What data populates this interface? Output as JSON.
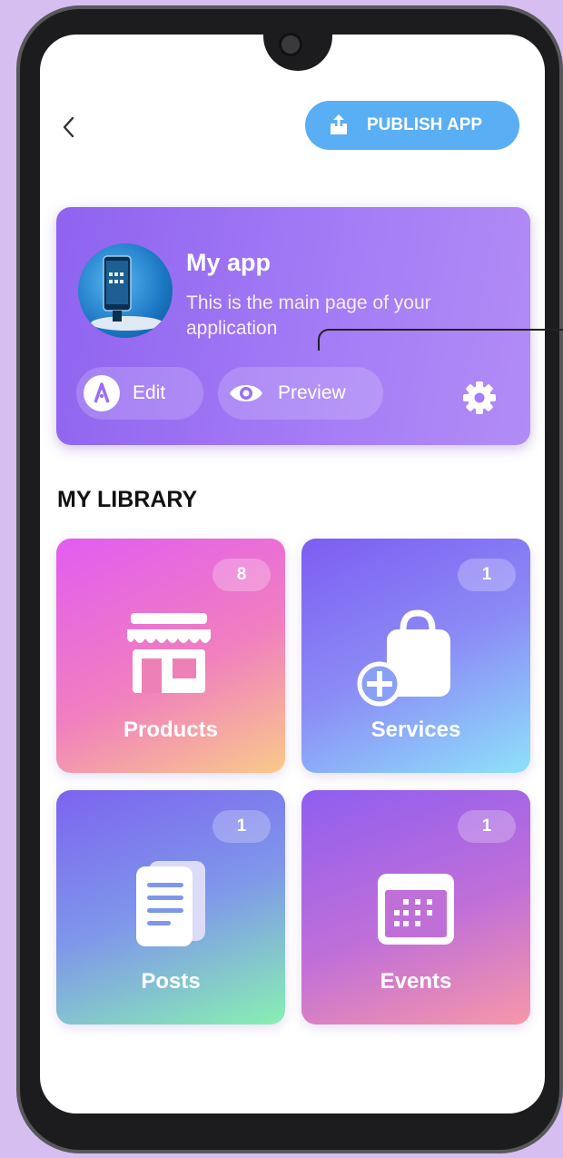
{
  "header": {
    "back_icon": "chevron-left-icon",
    "publish_label": "PUBLISH APP",
    "publish_icon": "share-upload-icon"
  },
  "app_card": {
    "title": "My app",
    "description": "This is the main page of your application",
    "edit_label": "Edit",
    "preview_label": "Preview",
    "settings_icon": "gear-icon"
  },
  "library": {
    "title": "MY LIBRARY",
    "tiles": [
      {
        "label": "Products",
        "count": "8",
        "icon": "store-icon"
      },
      {
        "label": "Services",
        "count": "1",
        "icon": "bag-plus-icon"
      },
      {
        "label": "Posts",
        "count": "1",
        "icon": "document-icon"
      },
      {
        "label": "Events",
        "count": "1",
        "icon": "calendar-icon"
      }
    ]
  },
  "colors": {
    "background": "#d6bff0",
    "publish_button": "#5aaef3",
    "app_card": "#9a6ff3"
  }
}
